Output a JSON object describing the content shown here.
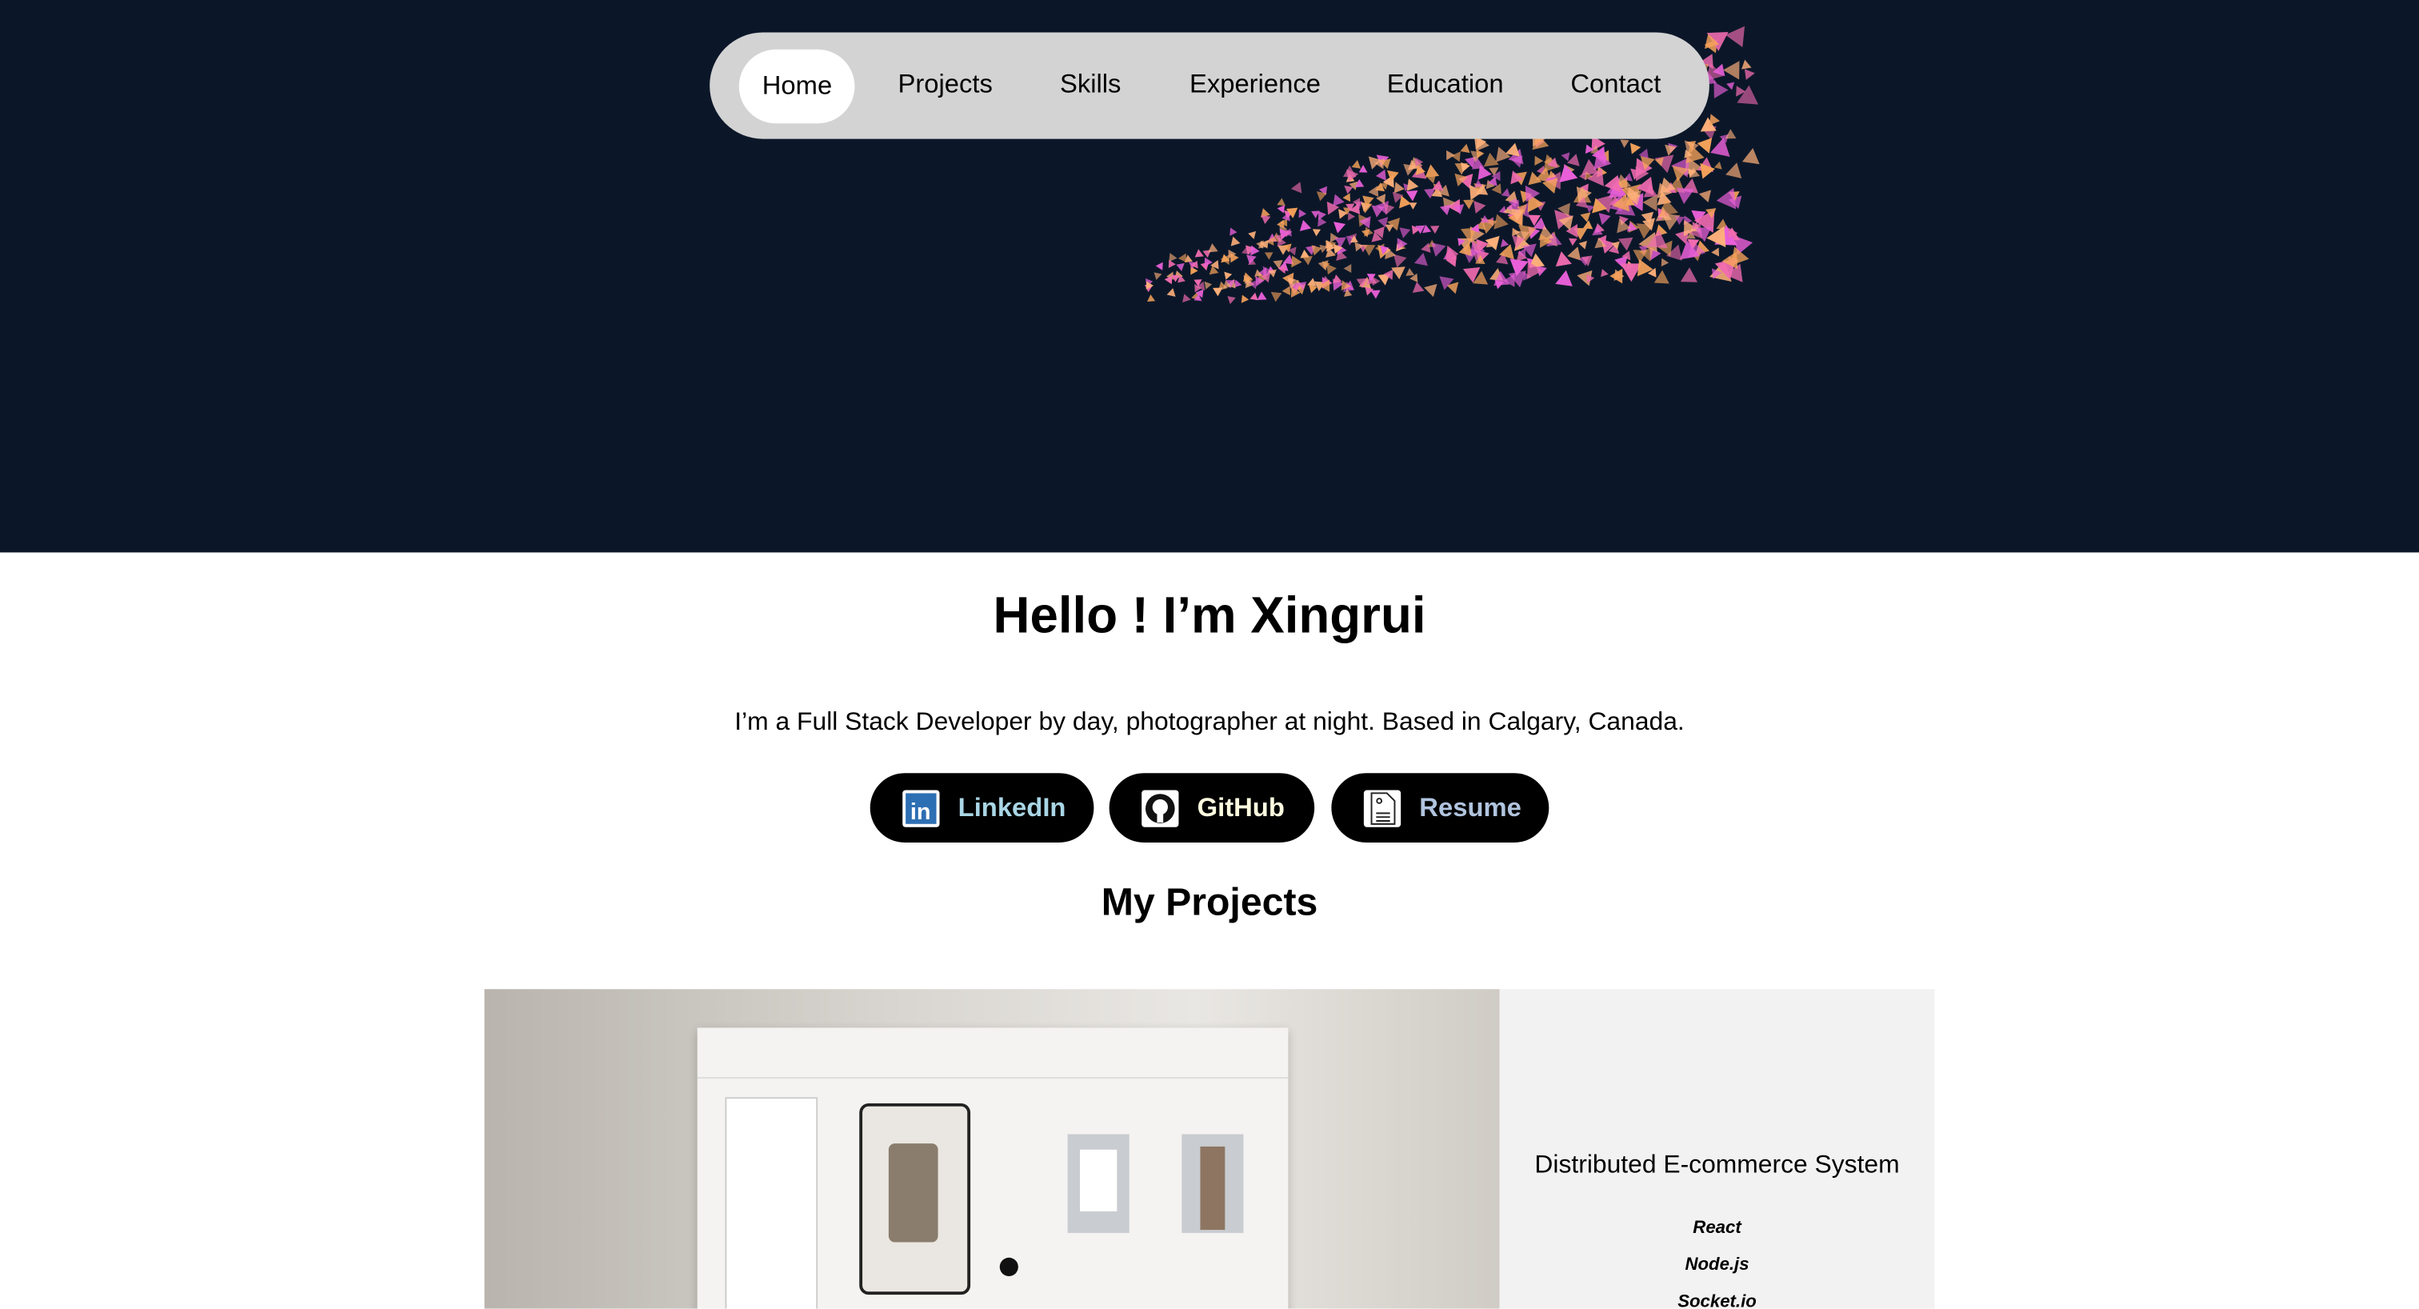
{
  "nav": {
    "items": [
      {
        "label": "Home",
        "active": true
      },
      {
        "label": "Projects"
      },
      {
        "label": "Skills"
      },
      {
        "label": "Experience"
      },
      {
        "label": "Education"
      },
      {
        "label": "Contact"
      }
    ]
  },
  "hero": {
    "bg_color": "#0b1729",
    "particle_colors": [
      "#f06bb0",
      "#f5a25a",
      "#e85fd8",
      "#ffb07a"
    ]
  },
  "intro": {
    "heading": "Hello ! I’m Xingrui",
    "subtitle": "I’m a Full Stack Developer by day, photographer at night. Based in Calgary, Canada."
  },
  "links": [
    {
      "label": "LinkedIn",
      "icon": "linkedin-icon",
      "color": "#a9d6e5"
    },
    {
      "label": "GitHub",
      "icon": "github-icon",
      "color": "#fffde0"
    },
    {
      "label": "Resume",
      "icon": "document-icon",
      "color": "#b0c4de"
    }
  ],
  "projects": {
    "heading": "My Projects",
    "items": [
      {
        "title": "Distributed E-commerce System",
        "tech": [
          "React",
          "Node.js",
          "Socket.io"
        ]
      }
    ]
  }
}
